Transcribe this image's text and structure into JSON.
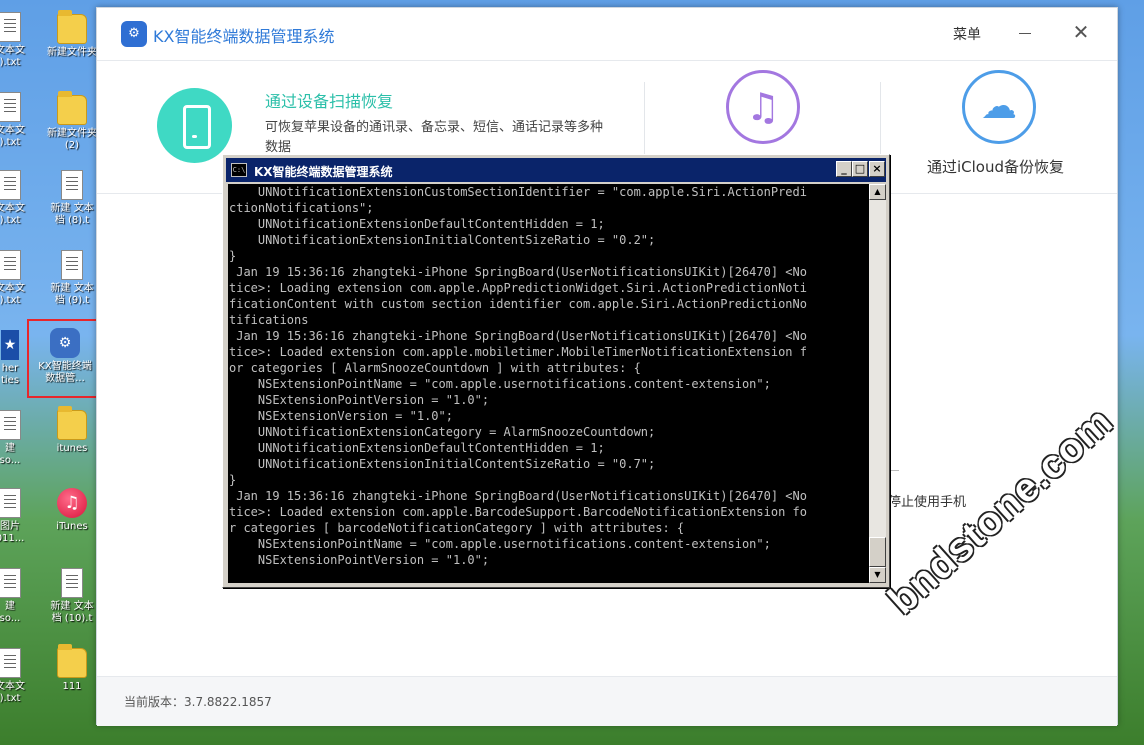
{
  "desktop": {
    "icons": [
      {
        "label": "文本文\n).txt",
        "kind": "doc"
      },
      {
        "label": "新建文件夹",
        "kind": "folder"
      },
      {
        "label": "文本文\n).txt",
        "kind": "doc"
      },
      {
        "label": "新建文件夹\n(2)",
        "kind": "folder"
      },
      {
        "label": "文本文\n).txt",
        "kind": "doc"
      },
      {
        "label": "新建 文本\n档 (8).t",
        "kind": "doc"
      },
      {
        "label": "文本文\n).txt",
        "kind": "doc"
      },
      {
        "label": "新建 文本\n档 (9).t",
        "kind": "doc"
      },
      {
        "label": "her\nties",
        "kind": "star"
      },
      {
        "label": "KX智能终端\n数据管...",
        "kind": "kx"
      },
      {
        "label": "建\nso...",
        "kind": "doc"
      },
      {
        "label": "itunes",
        "kind": "folder"
      },
      {
        "label": "图片\n011...",
        "kind": "doc"
      },
      {
        "label": "iTunes",
        "kind": "itunes"
      },
      {
        "label": "建\nso...",
        "kind": "doc"
      },
      {
        "label": "新建 文本\n档 (10).t",
        "kind": "doc"
      },
      {
        "label": "文本文\n).txt",
        "kind": "doc"
      },
      {
        "label": "111",
        "kind": "folder"
      }
    ]
  },
  "app": {
    "logo_glyph": "⚙",
    "title": "KX智能终端数据管理系统",
    "menu_label": "菜单",
    "close_glyph": "✕",
    "features": {
      "scan": {
        "title": "通过设备扫描恢复",
        "description": "可恢复苹果设备的通讯录、备忘录、短信、通话记录等多种数据"
      },
      "itunes": {
        "glyph": "♫"
      },
      "icloud": {
        "glyph": "☁",
        "label": "通过iCloud备份恢复"
      }
    },
    "hint_text": "停止使用手机",
    "version_text": "当前版本：3.7.8822.1857"
  },
  "console": {
    "title": "KX智能终端数据管理系统",
    "icon_text": "C:\\",
    "min_glyph": "_",
    "max_glyph": "□",
    "close_glyph": "×",
    "lines": [
      "    UNNotificationExtensionCustomSectionIdentifier = \"com.apple.Siri.ActionPredi",
      "ctionNotifications\";",
      "    UNNotificationExtensionDefaultContentHidden = 1;",
      "    UNNotificationExtensionInitialContentSizeRatio = \"0.2\";",
      "}",
      " Jan 19 15:36:16 zhangteki-iPhone SpringBoard(UserNotificationsUIKit)[26470] <No",
      "tice>: Loading extension com.apple.AppPredictionWidget.Siri.ActionPredictionNoti",
      "ficationContent with custom section identifier com.apple.Siri.ActionPredictionNo",
      "tifications",
      " Jan 19 15:36:16 zhangteki-iPhone SpringBoard(UserNotificationsUIKit)[26470] <No",
      "tice>: Loaded extension com.apple.mobiletimer.MobileTimerNotificationExtension f",
      "or categories [ AlarmSnoozeCountdown ] with attributes: {",
      "    NSExtensionPointName = \"com.apple.usernotifications.content-extension\";",
      "    NSExtensionPointVersion = \"1.0\";",
      "    NSExtensionVersion = \"1.0\";",
      "    UNNotificationExtensionCategory = AlarmSnoozeCountdown;",
      "    UNNotificationExtensionDefaultContentHidden = 1;",
      "    UNNotificationExtensionInitialContentSizeRatio = \"0.7\";",
      "}",
      " Jan 19 15:36:16 zhangteki-iPhone SpringBoard(UserNotificationsUIKit)[26470] <No",
      "tice>: Loaded extension com.apple.BarcodeSupport.BarcodeNotificationExtension fo",
      "r categories [ barcodeNotificationCategory ] with attributes: {",
      "    NSExtensionPointName = \"com.apple.usernotifications.content-extension\";",
      "    NSExtensionPointVersion = \"1.0\";"
    ]
  },
  "watermark": "bndstone.com"
}
